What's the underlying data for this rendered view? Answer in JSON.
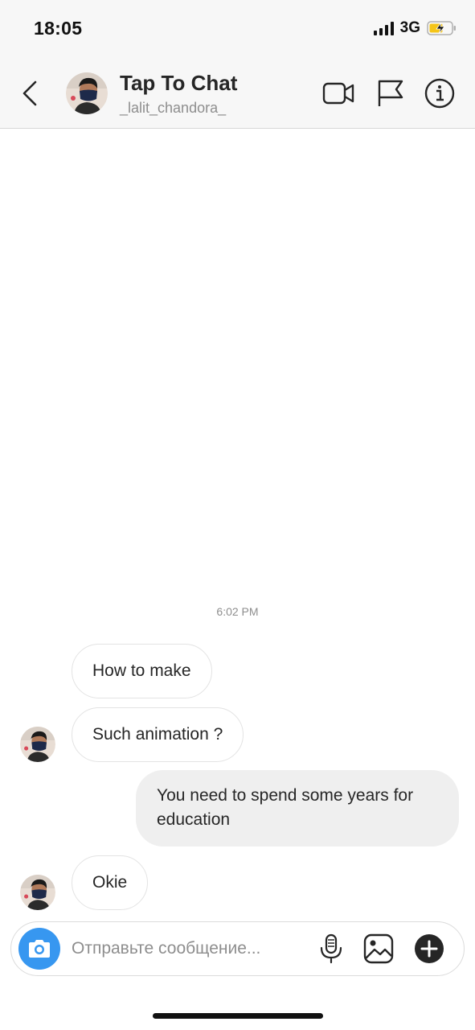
{
  "status_bar": {
    "time": "18:05",
    "network": "3G",
    "battery_color": "#f5c518"
  },
  "header": {
    "title": "Tap To Chat",
    "username": "_lalit_chandora_",
    "icons": [
      "back-chevron-icon",
      "video-call-icon",
      "flag-icon",
      "info-icon"
    ]
  },
  "conversation": {
    "timestamp": "6:02 PM",
    "messages": [
      {
        "direction": "incoming",
        "text": "How to make"
      },
      {
        "direction": "incoming",
        "text": "Such animation ?"
      },
      {
        "direction": "outgoing",
        "text": "You need to spend some years for education"
      },
      {
        "direction": "incoming",
        "text": "Okie"
      }
    ]
  },
  "composer": {
    "placeholder": "Отправьте сообщение...",
    "value": "",
    "icons": [
      "camera-icon",
      "microphone-icon",
      "gallery-icon",
      "add-icon"
    ],
    "accent_color": "#3797f0"
  }
}
